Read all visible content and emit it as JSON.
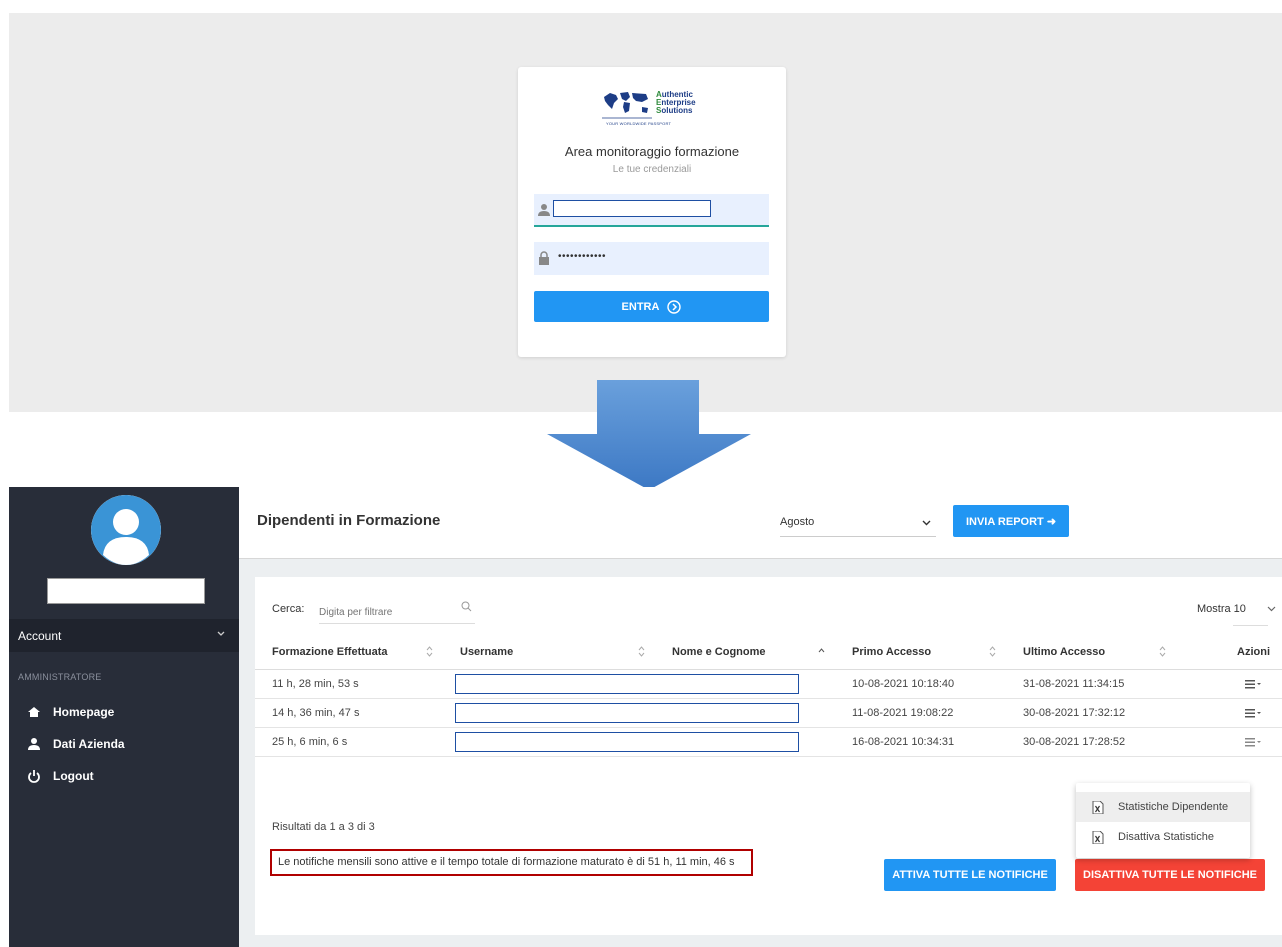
{
  "login": {
    "logo_lines": [
      "Authentic",
      "Enterprise",
      "Solutions"
    ],
    "logo_tagline": "YOUR WORLDWIDE PASSPORT",
    "title": "Area monitoraggio formazione",
    "subtitle": "Le tue credenziali",
    "username_value": "",
    "password_mask": "••••••••••••",
    "submit_label": "ENTRA"
  },
  "sidebar": {
    "account_label": "Account",
    "section_label": "AMMINISTRATORE",
    "items": [
      {
        "label": "Homepage",
        "icon": "home-icon"
      },
      {
        "label": "Dati Azienda",
        "icon": "user-icon"
      },
      {
        "label": "Logout",
        "icon": "power-icon"
      }
    ]
  },
  "header": {
    "title": "Dipendenti in Formazione",
    "month_selected": "Agosto",
    "report_button": "INVIA REPORT ➜"
  },
  "table": {
    "search_label": "Cerca:",
    "search_placeholder": "Digita per filtrare",
    "page_size_label": "Mostra 10",
    "columns": [
      "Formazione Effettuata",
      "Username",
      "Nome e Cognome",
      "Primo Accesso",
      "Ultimo Accesso",
      "Azioni"
    ],
    "rows": [
      {
        "formazione": "11 h, 28 min, 53 s",
        "primo": "10-08-2021 10:18:40",
        "ultimo": "31-08-2021 11:34:15"
      },
      {
        "formazione": "14 h, 36 min, 47 s",
        "primo": "11-08-2021 19:08:22",
        "ultimo": "30-08-2021 17:32:12"
      },
      {
        "formazione": "25 h, 6 min, 6 s",
        "primo": "16-08-2021 10:34:31",
        "ultimo": "30-08-2021 17:28:52"
      }
    ],
    "results_text": "Risultati da 1 a 3 di 3",
    "notice_text": "Le notifiche mensili sono attive e il tempo totale di formazione maturato è di 51 h, 11 min, 46 s",
    "enable_all_label": "ATTIVA TUTTE LE NOTIFICHE",
    "disable_all_label": "DISATTIVA TUTTE LE NOTIFICHE"
  },
  "action_menu": {
    "items": [
      "Statistiche Dipendente",
      "Disattiva Statistiche"
    ]
  },
  "colors": {
    "primary": "#2196f3",
    "danger": "#f44336",
    "sidebar": "#282d39",
    "highlight_border": "#b00000",
    "arrow": "#4a86cf"
  }
}
